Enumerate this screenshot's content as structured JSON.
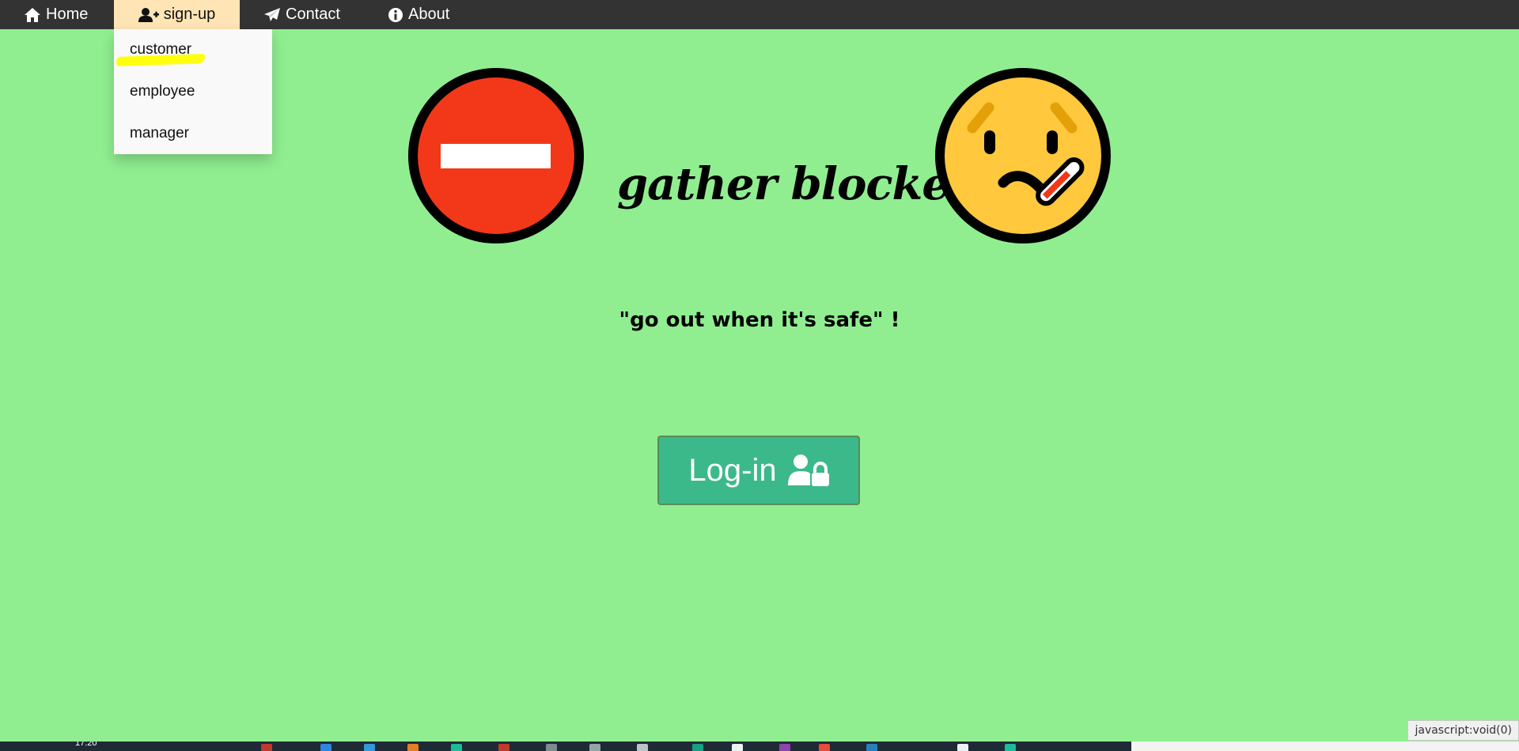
{
  "navbar": {
    "items": [
      {
        "label": "Home",
        "icon": "home-icon"
      },
      {
        "label": "sign-up",
        "icon": "user-plus-icon"
      },
      {
        "label": "Contact",
        "icon": "paper-plane-icon"
      },
      {
        "label": "About",
        "icon": "info-circle-icon"
      }
    ],
    "active_index": 1,
    "background": "#333333",
    "active_background": "#ffe4b5"
  },
  "dropdown": {
    "items": [
      {
        "label": "customer"
      },
      {
        "label": "employee"
      },
      {
        "label": "manager"
      }
    ],
    "highlight_color": "#ffff00"
  },
  "hero": {
    "title": "gather blocker",
    "left_icon": "no-entry-icon",
    "right_icon": "face-with-thermometer-icon",
    "tagline": "\"go out when it's safe\" !"
  },
  "login": {
    "label": "Log-in",
    "icon": "user-lock-icon",
    "color": "#3cb98a"
  },
  "status_bar": {
    "url": "javascript:void(0)"
  },
  "taskbar": {
    "clock": "17:20"
  },
  "colors": {
    "page_background": "#90ee90",
    "no_entry_red": "#f3381a",
    "face_yellow": "#ffc83d"
  }
}
